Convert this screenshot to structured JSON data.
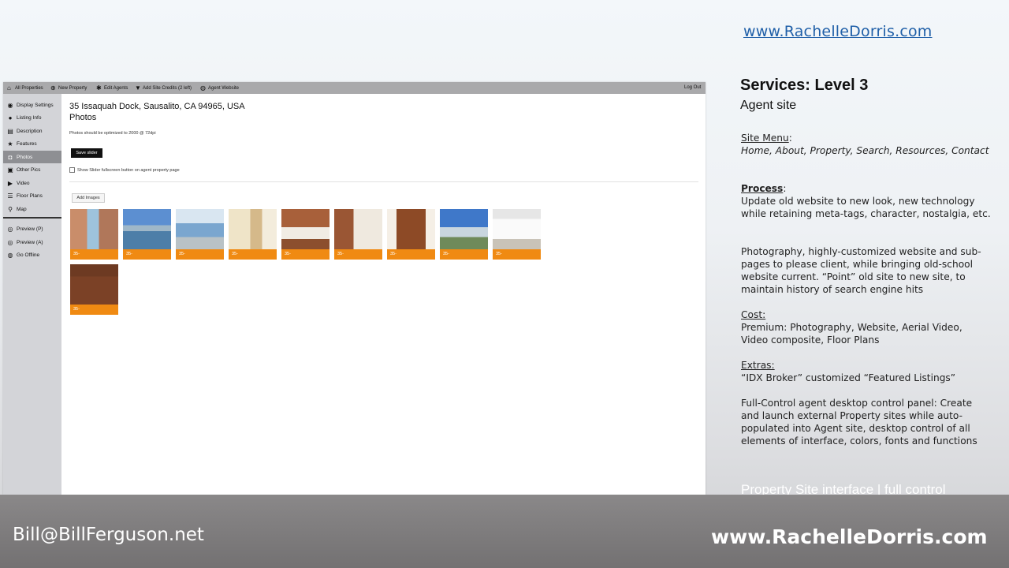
{
  "slide": {
    "top_url": "www.RachelleDorris.com",
    "services_title": "Services:  Level 3",
    "services_sub": "Agent site",
    "site_menu_label": "Site Menu",
    "site_menu_items": "Home,  About,  Property,  Search,  Resources, Contact",
    "process_label": "Process",
    "process_text_1": "Update old website to new look, new technology  while retaining meta-tags, character, nostalgia, etc.",
    "process_text_2": "Photography, highly-customized  website and sub-pages to please client, while bringing old-school website current. “Point” old site to new site, to maintain history  of search engine hits",
    "cost_label": "Cost:",
    "cost_text": "Premium: Photography, Website, Aerial Video, Video composite, Floor Plans",
    "extras_label": "Extras:",
    "extras_text": "“IDX Broker”  customized  “Featured Listings”",
    "fullcontrol_text": "Full-Control  agent desktop control  panel: Create and launch  external Property sites  while auto-populated into Agent site, desktop control of all elements of interface, colors, fonts and functions",
    "caption": "Property Site interface | full control",
    "email": "Bill@BillFerguson.net",
    "bottom_url": "www.RachelleDorris.com"
  },
  "app": {
    "topbar": {
      "all_properties": "All Properties",
      "new_property": "New Property",
      "edit_agents": "Edit Agents",
      "add_site_credits": "Add Site Credits (2 left)",
      "agent_website": "Agent Website",
      "log_out": "Log Out"
    },
    "sidebar": {
      "display_settings": "Display Settings",
      "listing_info": "Listing Info",
      "description": "Description",
      "features": "Features",
      "photos": "Photos",
      "other_pics": "Other Pics",
      "video": "Video",
      "floor_plans": "Floor Plans",
      "map": "Map",
      "preview_p": "Preview (P)",
      "preview_a": "Preview (A)",
      "go_offline": "Go Offline"
    },
    "main": {
      "address": "35 Issaquah Dock, Sausalito, CA 94965, USA",
      "title": "Photos",
      "note": "Photos should be optimized to 2000 @ 72dpi",
      "save_slider": "Save slider",
      "show_slider_label": "Show Slider fullscreen button on agent property page",
      "add_images": "Add Images"
    },
    "thumbnails": [
      {
        "label": "35-"
      },
      {
        "label": "35-"
      },
      {
        "label": "35-"
      },
      {
        "label": "35-"
      },
      {
        "label": "35-"
      },
      {
        "label": "35-"
      },
      {
        "label": "35-"
      },
      {
        "label": "35-"
      },
      {
        "label": "35-"
      },
      {
        "label": "35-"
      }
    ]
  },
  "colors": {
    "accent_orange": "#f08a12",
    "link_blue": "#1f5fa8",
    "topbar_gray": "#a9a9ab",
    "sidebar_gray": "#d3d4d8"
  }
}
